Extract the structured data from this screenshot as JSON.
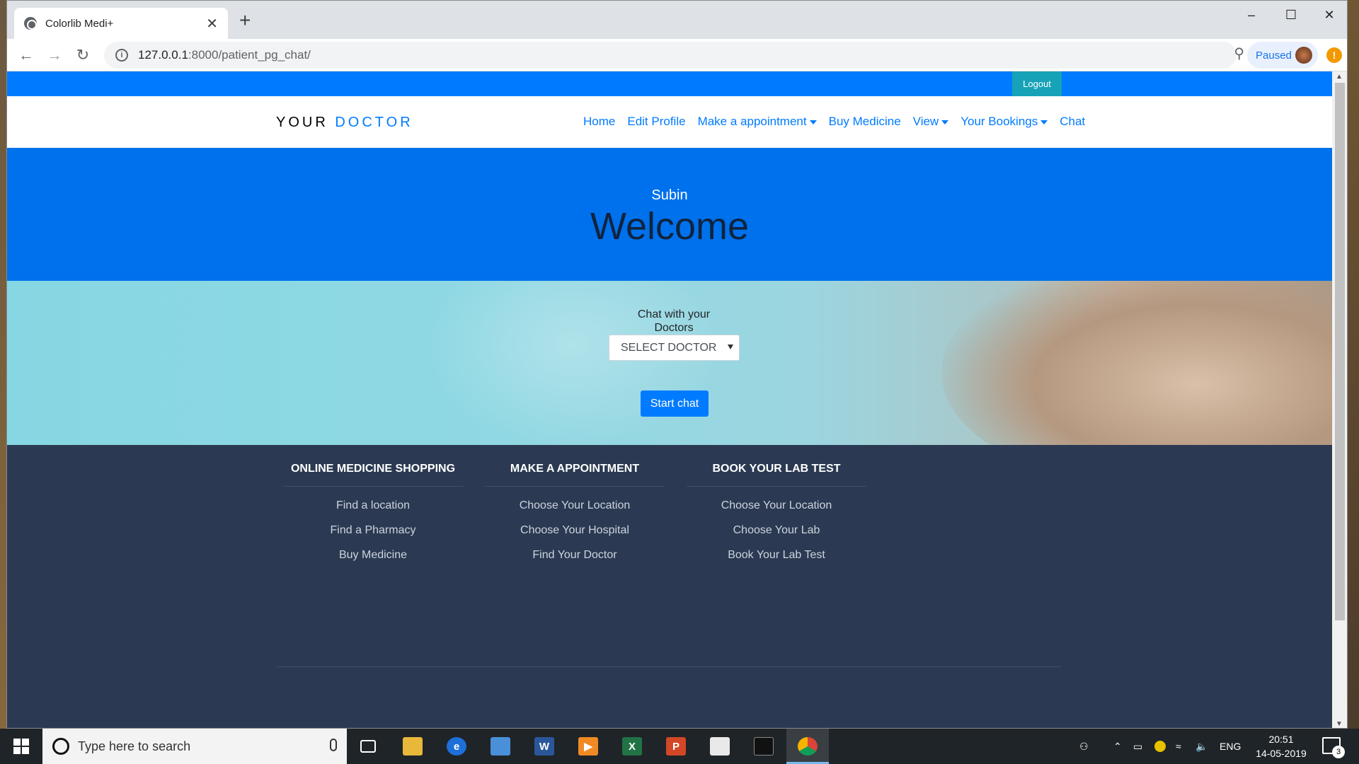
{
  "browser": {
    "tab_title": "Colorlib Medi+",
    "url_host": "127.0.0.1",
    "url_rest": ":8000/patient_pg_chat/",
    "profile_label": "Paused",
    "alert_glyph": "!"
  },
  "site": {
    "logout_label": "Logout",
    "brand_part1": "YOUR",
    "brand_part2": "DOCTOR",
    "nav": {
      "home": "Home",
      "edit_profile": "Edit Profile",
      "appointment": "Make a appointment",
      "buy_medicine": "Buy Medicine",
      "view": "View",
      "bookings": "Your Bookings",
      "chat": "Chat"
    },
    "hero": {
      "name": "Subin",
      "welcome": "Welcome"
    },
    "chat": {
      "label": "Chat with your Doctors",
      "select_value": "SELECT DOCTOR",
      "start_label": "Start chat"
    },
    "footer": {
      "col1": {
        "title": "ONLINE MEDICINE SHOPPING",
        "items": [
          "Find a location",
          "Find a Pharmacy",
          "Buy Medicine"
        ]
      },
      "col2": {
        "title": "MAKE A APPOINTMENT",
        "items": [
          "Choose Your Location",
          "Choose Your Hospital",
          "Find Your Doctor"
        ]
      },
      "col3": {
        "title": "BOOK YOUR LAB TEST",
        "items": [
          "Choose Your Location",
          "Choose Your Lab",
          "Book Your Lab Test"
        ]
      }
    }
  },
  "taskbar": {
    "search_placeholder": "Type here to search",
    "lang": "ENG",
    "time": "20:51",
    "date": "14-05-2019",
    "notif_count": "3"
  },
  "colors": {
    "primary": "#007bff",
    "hero": "#0071ec",
    "footer": "#2b3a52",
    "logout": "#17a2b8"
  }
}
